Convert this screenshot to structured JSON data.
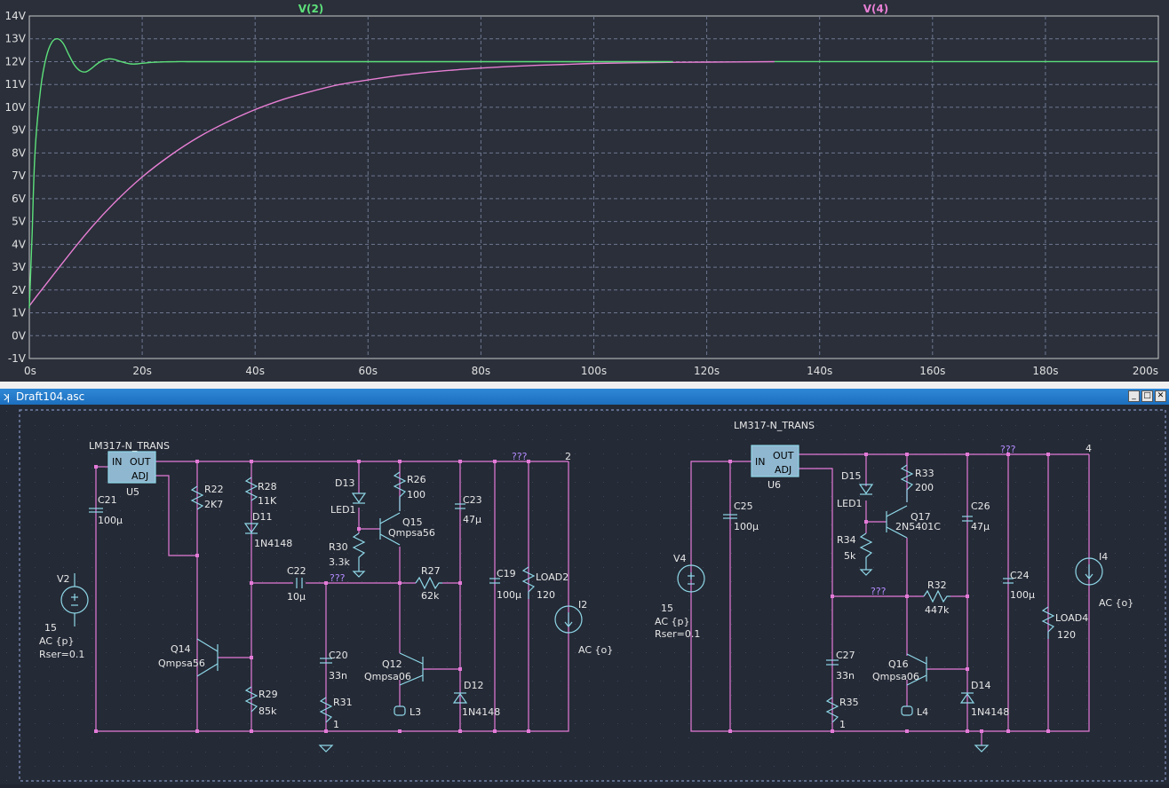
{
  "plot": {
    "traces": [
      {
        "name": "V(2)",
        "color": "#5de07a"
      },
      {
        "name": "V(4)",
        "color": "#e87fd4"
      }
    ],
    "y_ticks": [
      "14V",
      "13V",
      "12V",
      "11V",
      "10V",
      "9V",
      "8V",
      "7V",
      "6V",
      "5V",
      "4V",
      "3V",
      "2V",
      "1V",
      "0V",
      "-1V"
    ],
    "x_ticks": [
      "0s",
      "20s",
      "40s",
      "60s",
      "80s",
      "100s",
      "120s",
      "140s",
      "160s",
      "180s",
      "200s"
    ]
  },
  "chart_data": {
    "type": "line",
    "xlim": [
      0,
      200
    ],
    "ylim": [
      -1,
      14
    ],
    "xlabel": "",
    "ylabel": "",
    "grid": true,
    "series": [
      {
        "name": "V(2)",
        "color": "#5de07a",
        "x": [
          0,
          0.5,
          1,
          2,
          3,
          4,
          5,
          6,
          7,
          8,
          9,
          10,
          11,
          12,
          13,
          14,
          15,
          16,
          17,
          18,
          19,
          20,
          22,
          24,
          26,
          28,
          30,
          40,
          60,
          80,
          100,
          114
        ],
        "y": [
          1.2,
          4.5,
          8.0,
          10.8,
          12.2,
          12.85,
          13.0,
          12.8,
          12.3,
          11.85,
          11.6,
          11.55,
          11.7,
          11.9,
          12.05,
          12.12,
          12.1,
          12.02,
          11.95,
          11.9,
          11.9,
          11.93,
          11.97,
          11.99,
          12.0,
          12.0,
          12.0,
          12.0,
          12.0,
          12.0,
          12.0,
          12.0
        ]
      },
      {
        "name": "V(4)",
        "color": "#e87fd4",
        "x": [
          0,
          2,
          5,
          10,
          15,
          20,
          25,
          30,
          35,
          40,
          45,
          50,
          55,
          60,
          65,
          70,
          75,
          80,
          85,
          90,
          95,
          100,
          110,
          120,
          132
        ],
        "y": [
          1.3,
          1.95,
          2.9,
          4.45,
          5.8,
          6.95,
          7.9,
          8.7,
          9.35,
          9.9,
          10.35,
          10.7,
          11.0,
          11.2,
          11.38,
          11.52,
          11.63,
          11.72,
          11.79,
          11.84,
          11.88,
          11.92,
          11.96,
          11.98,
          12.0
        ]
      }
    ]
  },
  "window": {
    "title": "Draft104.asc"
  },
  "schematic": {
    "labels": {
      "lm317_a": "LM317-N_TRANS",
      "in_a": "IN",
      "out_a": "OUT",
      "adj_a": "ADJ",
      "u5": "U5",
      "c21": "C21",
      "c21v": "100µ",
      "v2": "V2",
      "v2a": "15",
      "v2b": "AC {p}",
      "v2c": "Rser=0.1",
      "r22": "R22",
      "r22v": "2K7",
      "r28": "R28",
      "r28v": "11K",
      "d11": "D11",
      "d11v": "1N4148",
      "d13": "D13",
      "led1a": "LED1",
      "r30": "R30",
      "r30v": "3.3k",
      "r26": "R26",
      "r26v": "100",
      "q15": "Q15",
      "q15v": "Qmpsa56",
      "c23": "C23",
      "c23v": "47µ",
      "c22": "C22",
      "c22v": "10µ",
      "qqq1": "???",
      "qqq2": "???",
      "r27": "R27",
      "r27v": "62k",
      "c19": "C19",
      "c19v": "100µ",
      "load2": "LOAD2",
      "load2v": "120",
      "n2": "2",
      "i2": "I2",
      "i2v": "AC {o}",
      "q14": "Q14",
      "q14v": "Qmpsa56",
      "c20": "C20",
      "c20v": "33n",
      "r29": "R29",
      "r29v": "85k",
      "r31": "R31",
      "r31v": "1",
      "q12": "Q12",
      "q12v": "Qmpsa06",
      "l3": "L3",
      "d12": "D12",
      "d12v": "1N4148",
      "lm317_b": "LM317-N_TRANS",
      "in_b": "IN",
      "out_b": "OUT",
      "adj_b": "ADJ",
      "u6": "U6",
      "c25": "C25",
      "c25v": "100µ",
      "v4": "V4",
      "v4a": "15",
      "v4b": "AC {p}",
      "v4c": "Rser=0.1",
      "d15": "D15",
      "led1b": "LED1",
      "r33": "R33",
      "r33v": "200",
      "q17": "Q17",
      "q17v": "2N5401C",
      "r34": "R34",
      "r34v": "5k",
      "c26": "C26",
      "c26v": "47µ",
      "qqq3": "???",
      "qqq4": "???",
      "r32": "R32",
      "r32v": "447k",
      "c24": "C24",
      "c24v": "100µ",
      "load4": "LOAD4",
      "load4v": "120",
      "n4": "4",
      "i4": "I4",
      "i4v": "AC {o}",
      "c27": "C27",
      "c27v": "33n",
      "r35": "R35",
      "r35v": "1",
      "q16": "Q16",
      "q16v": "Qmpsa06",
      "l4": "L4",
      "d14": "D14",
      "d14v": "1N4148"
    }
  }
}
